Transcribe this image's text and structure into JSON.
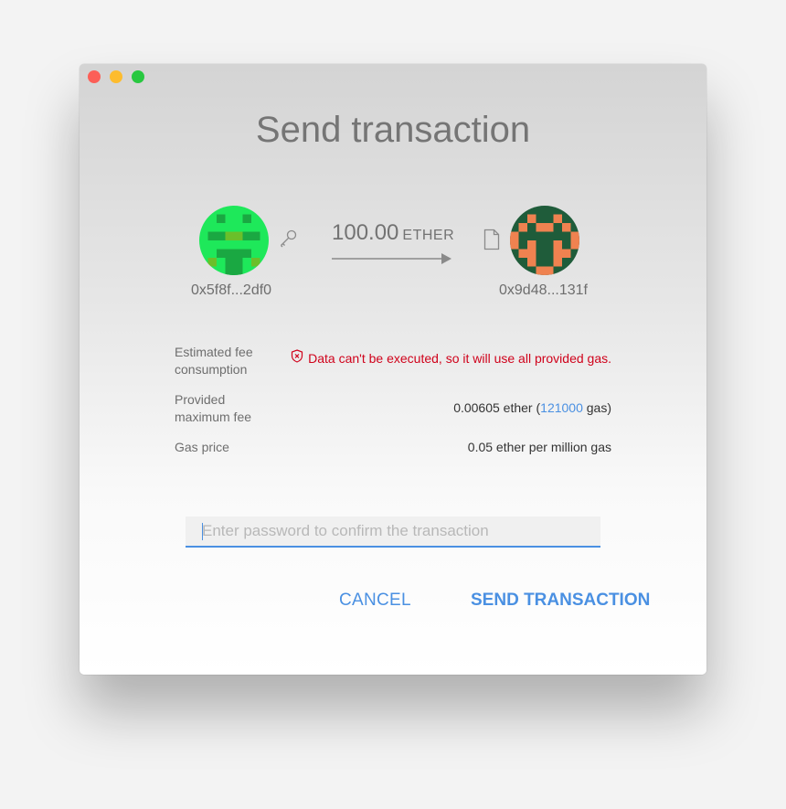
{
  "window": {
    "title": "Send transaction"
  },
  "transfer": {
    "from_address": "0x5f8f...2df0",
    "to_address": "0x9d48...131f",
    "amount": "100.00",
    "unit": "ETHER",
    "from_icon": "key-icon",
    "to_icon": "document-icon"
  },
  "details": {
    "estimated_fee_label": "Estimated fee\nconsumption",
    "estimated_fee_warning": "Data can't be executed, so it will use all provided gas.",
    "provided_fee_label": "Provided\nmaximum fee",
    "provided_fee_value_prefix": "0.00605 ether (",
    "provided_fee_gas": "121000",
    "provided_fee_value_suffix": " gas)",
    "gas_price_label": "Gas price",
    "gas_price_value": "0.05 ether per million gas"
  },
  "password": {
    "value": "",
    "placeholder": "Enter password to confirm the transaction"
  },
  "buttons": {
    "cancel": "CANCEL",
    "send": "SEND TRANSACTION"
  },
  "colors": {
    "accent": "#4a90e2",
    "error": "#d0021b",
    "from_identicon": "#1ee85a",
    "to_identicon": "#ef8250"
  }
}
